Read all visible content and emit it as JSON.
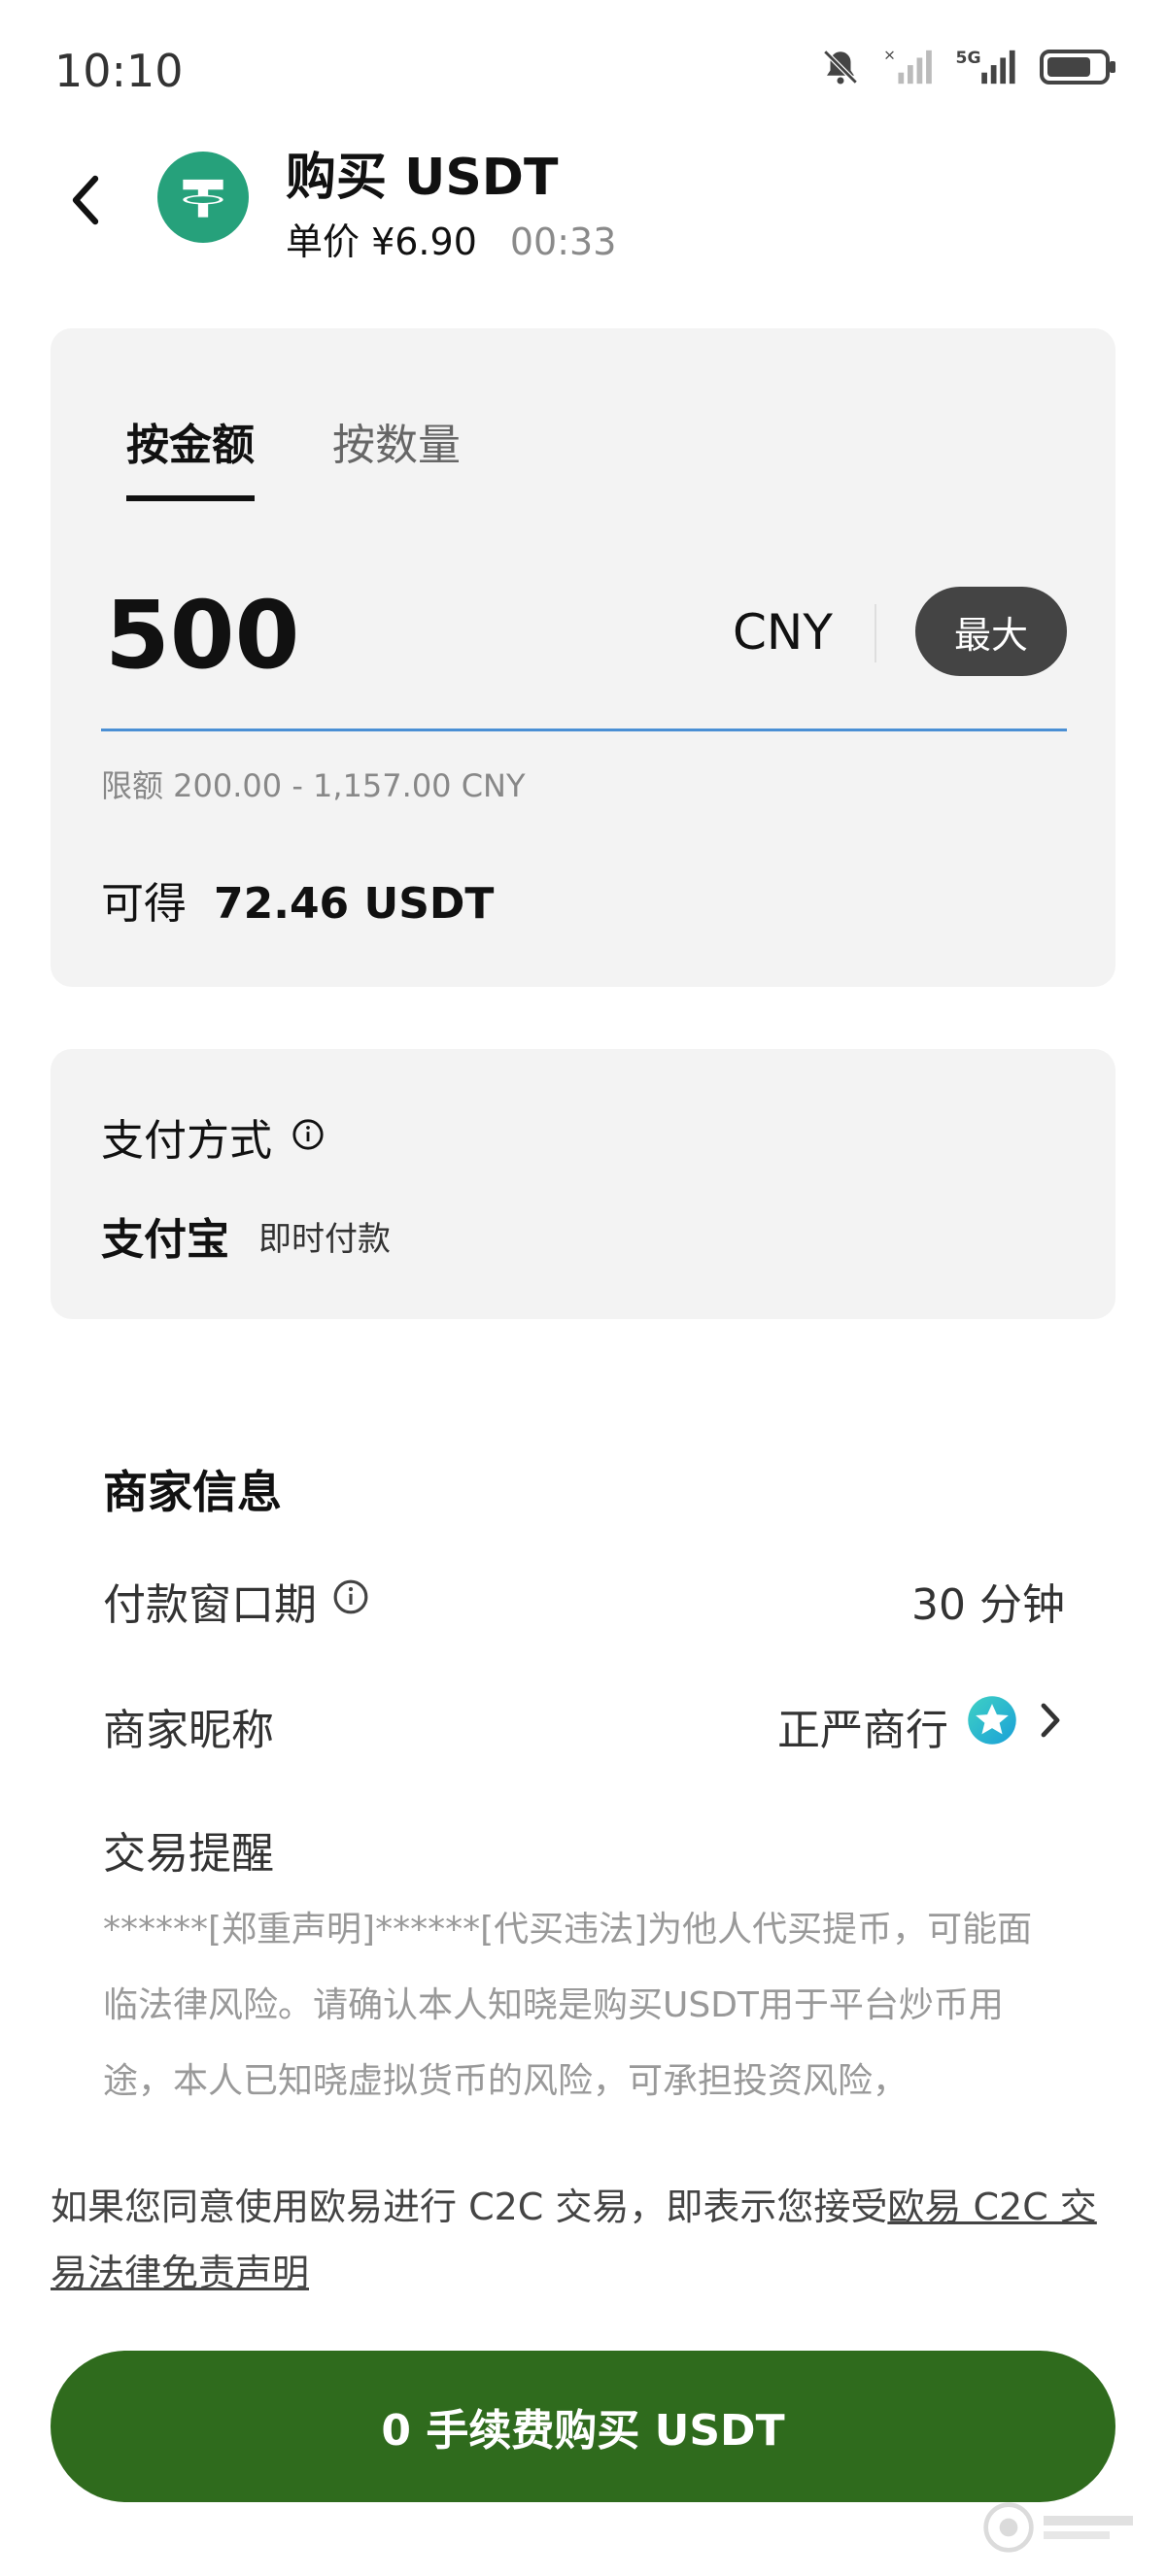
{
  "status_bar": {
    "time": "10:10",
    "network": "5G"
  },
  "header": {
    "title": "购买 USDT",
    "unit_price": "单价 ¥6.90",
    "countdown": "00:33"
  },
  "amount_card": {
    "tabs": [
      {
        "label": "按金额",
        "active": true
      },
      {
        "label": "按数量",
        "active": false
      }
    ],
    "amount_value": "500",
    "currency": "CNY",
    "max_label": "最大",
    "limit_text": "限额 200.00 - 1,157.00 CNY",
    "receive_label": "可得",
    "receive_value": "72.46 USDT"
  },
  "payment_card": {
    "title": "支付方式",
    "method": "支付宝",
    "method_tag": "即时付款"
  },
  "merchant": {
    "section_title": "商家信息",
    "pay_window_label": "付款窗口期",
    "pay_window_value": "30 分钟",
    "nickname_label": "商家昵称",
    "nickname_value": "正严商行",
    "reminder_title": "交易提醒",
    "reminder_text": "******[郑重声明]******[代买违法]为他人代买提币，可能面临法律风险。请确认本人知晓是购买USDT用于平台炒币用途，本人已知晓虚拟货币的风险，可承担投资风险，"
  },
  "consent": {
    "prefix": "如果您同意使用欧易进行 C2C 交易，即表示您接受",
    "link": "欧易 C2C 交易法律免责声明"
  },
  "buy_button": {
    "label": "0 手续费购买 USDT"
  },
  "colors": {
    "button_green": "#2f6b1d",
    "tether_green": "#26a17b",
    "input_underline": "#4a8fd4",
    "card_bg": "#f3f3f3"
  }
}
